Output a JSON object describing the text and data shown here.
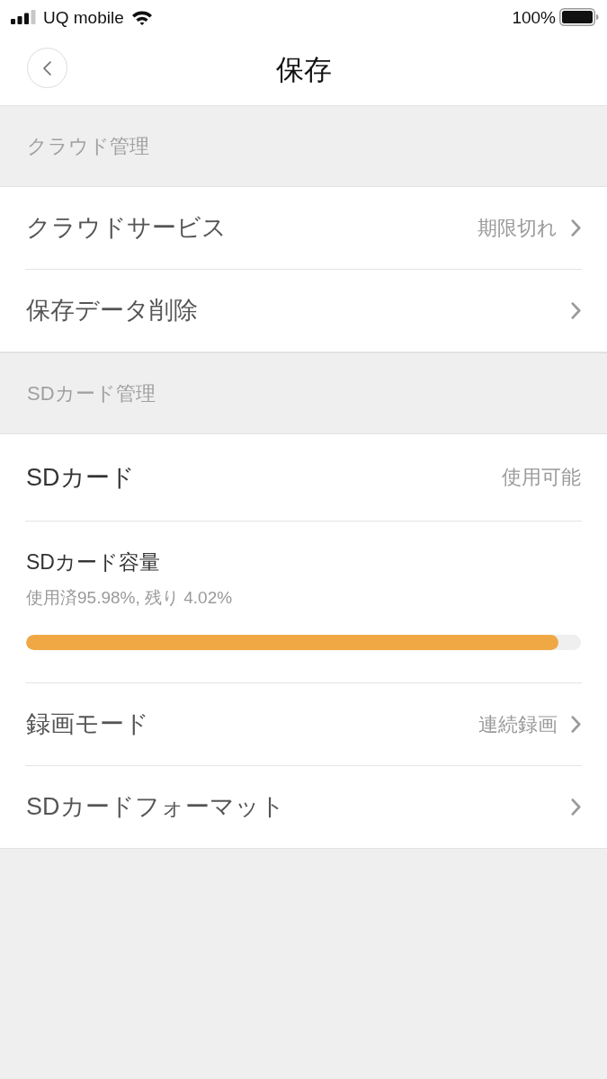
{
  "status_bar": {
    "carrier": "UQ mobile",
    "battery": "100%"
  },
  "nav": {
    "title": "保存"
  },
  "sections": [
    {
      "header": "クラウド管理",
      "rows": [
        {
          "kind": "link",
          "label": "クラウドサービス",
          "value": "期限切れ"
        },
        {
          "kind": "link",
          "label": "保存データ削除"
        }
      ]
    },
    {
      "header": "SDカード管理",
      "rows": [
        {
          "kind": "static",
          "label": "SDカード",
          "value": "使用可能"
        },
        {
          "kind": "capacity",
          "label": "SDカード容量",
          "detail": "使用済95.98%, 残り 4.02%",
          "level": 0.9598
        },
        {
          "kind": "link",
          "label": "録画モード",
          "value": "連続録画"
        },
        {
          "kind": "link",
          "label": "SDカードフォーマット"
        }
      ]
    }
  ]
}
